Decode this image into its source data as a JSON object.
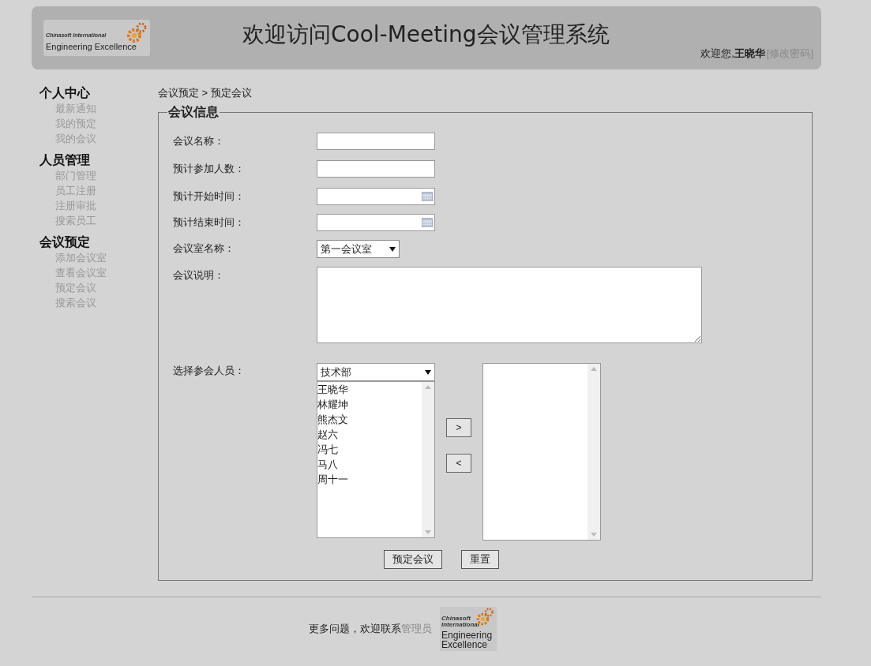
{
  "header": {
    "logo": {
      "line1": "Chinasoft International",
      "line2": "Engineering Excellence"
    },
    "title": "欢迎访问Cool-Meeting会议管理系统",
    "welcome": "欢迎您,",
    "user": "王晓华",
    "change_password": "[修改密码]"
  },
  "sidebar": [
    {
      "title": "个人中心",
      "items": [
        "最新通知",
        "我的预定",
        "我的会议"
      ]
    },
    {
      "title": "人员管理",
      "items": [
        "部门管理",
        "员工注册",
        "注册审批",
        "搜索员工"
      ]
    },
    {
      "title": "会议预定",
      "items": [
        "添加会议室",
        "查看会议室",
        "预定会议",
        "搜索会议"
      ]
    }
  ],
  "breadcrumb": "会议预定 > 预定会议",
  "form": {
    "legend": "会议信息",
    "fields": [
      {
        "kind": "text",
        "label": "会议名称："
      },
      {
        "kind": "text",
        "label": "预计参加人数："
      },
      {
        "kind": "date",
        "label": "预计开始时间："
      },
      {
        "kind": "date",
        "label": "预计结束时间："
      },
      {
        "kind": "select",
        "label": "会议室名称：",
        "value": "第一会议室"
      },
      {
        "kind": "textarea",
        "label": "会议说明："
      }
    ],
    "attendees": {
      "label": "选择参会人员：",
      "department": "技术部",
      "available": [
        "王晓华",
        "林耀坤",
        "熊杰文",
        "赵六",
        "冯七",
        "马八",
        "周十一"
      ],
      "move_right": ">",
      "move_left": "<"
    },
    "buttons": [
      "预定会议",
      "重置"
    ]
  },
  "footer": {
    "text": "更多问题，欢迎联系",
    "link": "管理员",
    "logo": {
      "line1": "Chinasoft",
      "line2": "International",
      "line3": "Engineering",
      "line4": "Excellence"
    }
  }
}
